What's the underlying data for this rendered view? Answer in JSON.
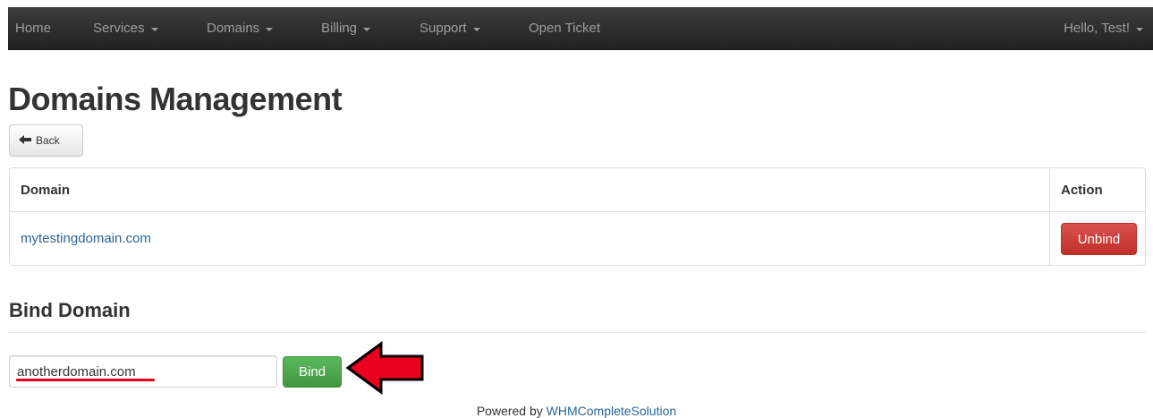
{
  "nav": {
    "home": "Home",
    "services": "Services",
    "domains": "Domains",
    "billing": "Billing",
    "support": "Support",
    "open_ticket": "Open Ticket",
    "user_greeting": "Hello, Test!"
  },
  "page": {
    "title": "Domains Management",
    "back_label": "Back"
  },
  "table": {
    "headers": {
      "domain": "Domain",
      "action": "Action"
    },
    "rows": [
      {
        "domain": "mytestingdomain.com",
        "action_label": "Unbind"
      }
    ]
  },
  "bind": {
    "section_title": "Bind Domain",
    "input_value": "anotherdomain.com",
    "button_label": "Bind"
  },
  "footer": {
    "prefix": "Powered by",
    "link_text": "WHMCompleteSolution"
  },
  "colors": {
    "navbar": "#222222",
    "danger": "#d9534f",
    "success": "#5cb85c",
    "link": "#2a6496",
    "annotation_arrow": "#e8001c"
  },
  "icons": {
    "back": "arrow-left-icon",
    "caret": "chevron-down-icon",
    "annotation": "red-arrow-icon"
  }
}
